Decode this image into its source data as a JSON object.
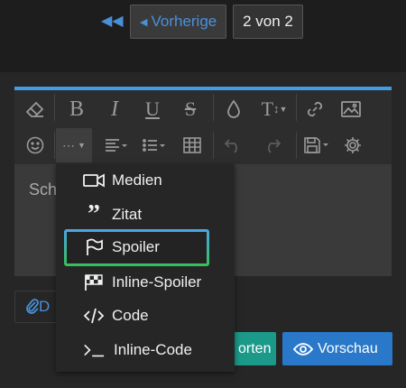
{
  "pagination": {
    "first_icon": "double-chevron-left-icon",
    "prev_label": "Vorherige",
    "page_label": "2 von 2"
  },
  "editor": {
    "placeholder_visible": "Sch",
    "toolbar_row1": [
      "eraser-icon",
      "bold-icon",
      "italic-icon",
      "underline-icon",
      "strikethrough-icon",
      "color-drop-icon",
      "text-size-icon",
      "link-icon",
      "image-icon"
    ],
    "toolbar_row2": [
      "smiley-icon",
      "more-icon",
      "align-icon",
      "list-icon",
      "table-icon",
      "undo-icon",
      "redo-icon",
      "save-icon",
      "gear-icon"
    ]
  },
  "menu": {
    "items": [
      {
        "label": "Medien",
        "icon": "video-icon"
      },
      {
        "label": "Zitat",
        "icon": "quote-icon"
      },
      {
        "label": "Spoiler",
        "icon": "flag-icon"
      },
      {
        "label": "Inline-Spoiler",
        "icon": "checkered-flag-icon"
      },
      {
        "label": "Code",
        "icon": "code-icon"
      },
      {
        "label": "Inline-Code",
        "icon": "terminal-icon"
      }
    ],
    "highlighted": "Spoiler"
  },
  "buttons": {
    "attach_label": "D",
    "save_label": "orten",
    "preview_label": "Vorschau"
  },
  "colors": {
    "accent_blue": "#3f9de3",
    "link_blue": "#4a90d9",
    "save_teal": "#1b9a8a",
    "preview_blue": "#2a78c9",
    "highlight_green": "#34c15a"
  }
}
